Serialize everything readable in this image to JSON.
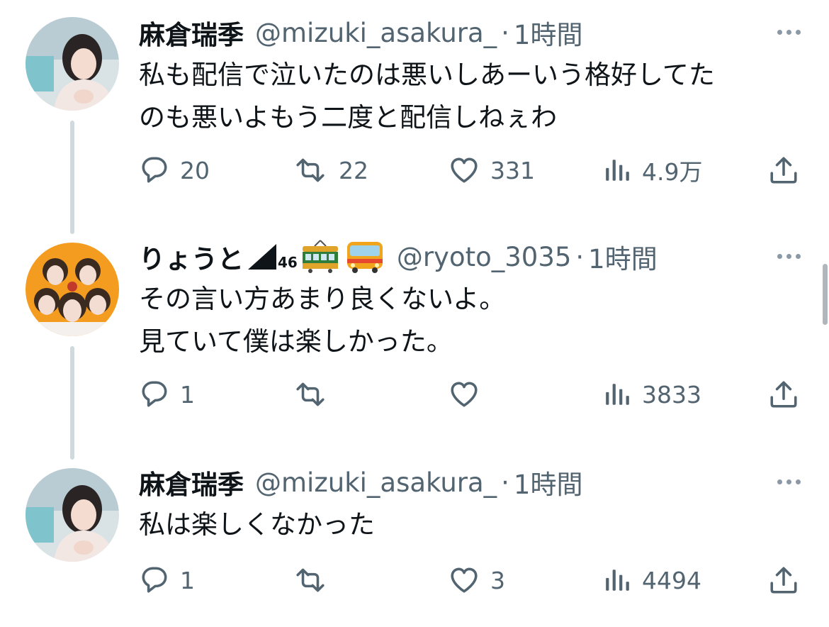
{
  "tweets": [
    {
      "name": "麻倉瑞季",
      "handle": "@mizuki_asakura_",
      "separator": "·",
      "time": "1時間",
      "lines": [
        "私も配信で泣いたのは悪いしあーいう格好してた",
        "のも悪いよもう二度と配信しねぇわ"
      ],
      "replies": "20",
      "retweets": "22",
      "likes": "331",
      "views": "4.9万"
    },
    {
      "name": "りょうと",
      "name_badge_number": "46",
      "name_emojis": [
        "tram-emoji",
        "bus-emoji"
      ],
      "handle": "@ryoto_3035",
      "separator": "·",
      "time": "1時間",
      "lines": [
        "その言い方あまり良くないよ。",
        "見ていて僕は楽しかった。"
      ],
      "replies": "1",
      "retweets": "",
      "likes": "",
      "views": "3833"
    },
    {
      "name": "麻倉瑞季",
      "handle": "@mizuki_asakura_",
      "separator": "·",
      "time": "1時間",
      "lines": [
        "私は楽しくなかった"
      ],
      "replies": "1",
      "retweets": "",
      "likes": "3",
      "views": "4494"
    }
  ],
  "colors": {
    "text": "#0f1419",
    "secondary": "#536471",
    "thread_line": "#cfd9de",
    "avatar2_bg": "#f39c1f"
  }
}
